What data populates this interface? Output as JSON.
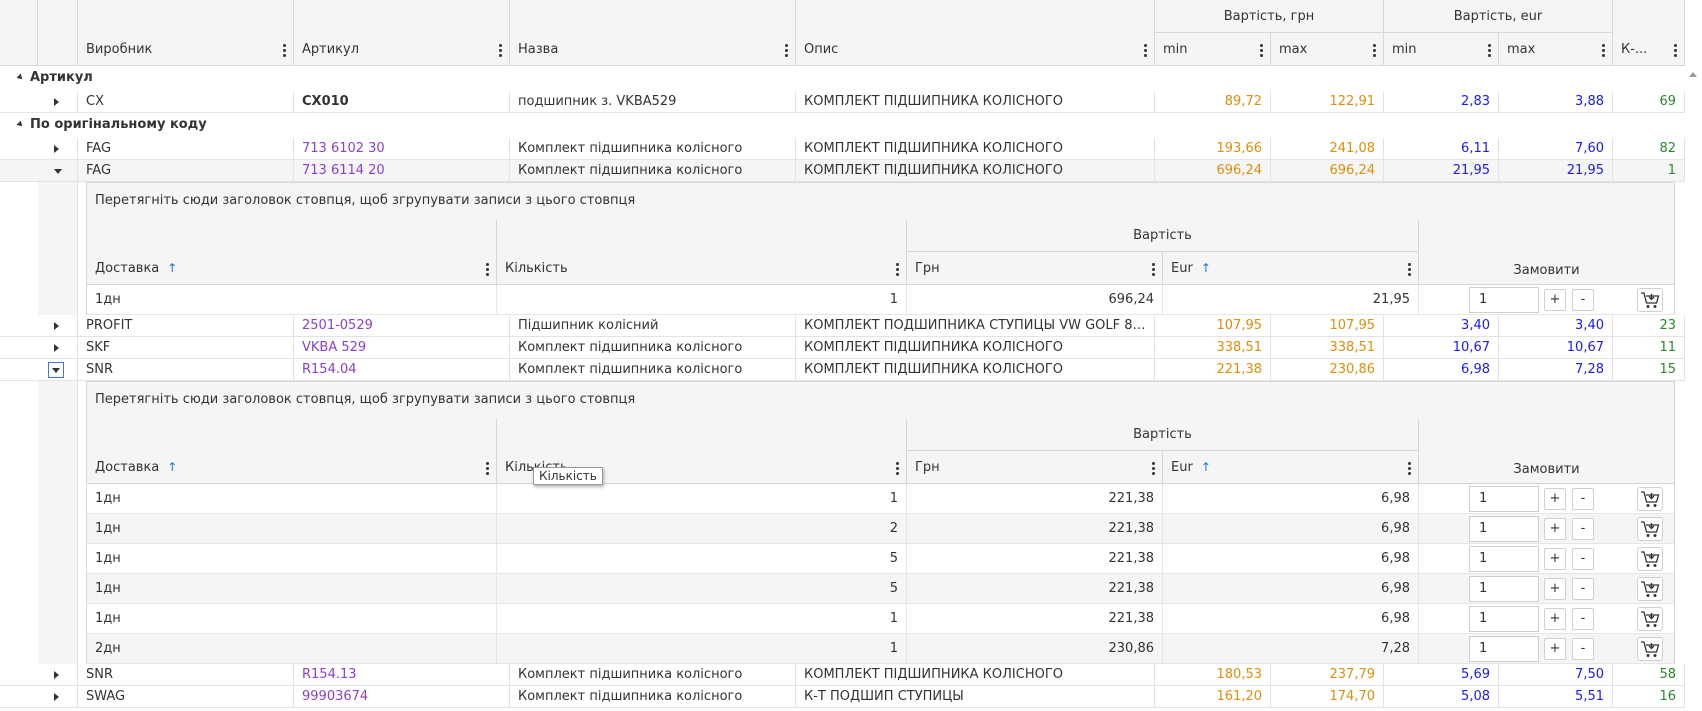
{
  "columns": {
    "manufacturer": "Виробник",
    "article": "Артикул",
    "name": "Назва",
    "description": "Опис",
    "price_uah_group": "Вартість, грн",
    "price_eur_group": "Вартість, eur",
    "min": "min",
    "max": "max",
    "qty_short": "К-..."
  },
  "groups": {
    "article": "Артикул",
    "original": "По оригінальному коду"
  },
  "rows": [
    {
      "manufacturer": "CX",
      "article": "CX010",
      "name": "подшипник з. VKBA529",
      "description": "КОМПЛЕКТ ПІДШИПНИКА КОЛІСНОГО",
      "uah_min": "89,72",
      "uah_max": "122,91",
      "eur_min": "2,83",
      "eur_max": "3,88",
      "count": "69"
    },
    {
      "manufacturer": "FAG",
      "article": "713 6102 30",
      "name": "Комплект підшипника колісного",
      "description": "КОМПЛЕКТ ПІДШИПНИКА КОЛІСНОГО",
      "uah_min": "193,66",
      "uah_max": "241,08",
      "eur_min": "6,11",
      "eur_max": "7,60",
      "count": "82"
    },
    {
      "manufacturer": "FAG",
      "article": "713 6114 20",
      "name": "Комплект підшипника колісного",
      "description": "КОМПЛЕКТ ПІДШИПНИКА КОЛІСНОГО",
      "uah_min": "696,24",
      "uah_max": "696,24",
      "eur_min": "21,95",
      "eur_max": "21,95",
      "count": "1"
    },
    {
      "manufacturer": "PROFIT",
      "article": "2501-0529",
      "name": "Підшипник колісний",
      "description": "КОМПЛЕКТ ПОДШИПНИКА СТУПИЦЫ VW GOLF 85...",
      "uah_min": "107,95",
      "uah_max": "107,95",
      "eur_min": "3,40",
      "eur_max": "3,40",
      "count": "23"
    },
    {
      "manufacturer": "SKF",
      "article": "VKBA 529",
      "name": "Комплект підшипника колісного",
      "description": "КОМПЛЕКТ ПІДШИПНИКА КОЛІСНОГО",
      "uah_min": "338,51",
      "uah_max": "338,51",
      "eur_min": "10,67",
      "eur_max": "10,67",
      "count": "11"
    },
    {
      "manufacturer": "SNR",
      "article": "R154.04",
      "name": "Комплект підшипника колісного",
      "description": "КОМПЛЕКТ ПІДШИПНИКА КОЛІСНОГО",
      "uah_min": "221,38",
      "uah_max": "230,86",
      "eur_min": "6,98",
      "eur_max": "7,28",
      "count": "15"
    },
    {
      "manufacturer": "SNR",
      "article": "R154.13",
      "name": "Комплект підшипника колісного",
      "description": "КОМПЛЕКТ ПІДШИПНИКА КОЛІСНОГО",
      "uah_min": "180,53",
      "uah_max": "237,79",
      "eur_min": "5,69",
      "eur_max": "7,50",
      "count": "58"
    },
    {
      "manufacturer": "SWAG",
      "article": "99903674",
      "name": "Комплект підшипника колісного",
      "description": "К-Т ПОДШИП СТУПИЦЫ",
      "uah_min": "161,20",
      "uah_max": "174,70",
      "eur_min": "5,08",
      "eur_max": "5,51",
      "count": "16"
    }
  ],
  "detail": {
    "group_panel": "Перетягніть сюди заголовок стовпця, щоб згрупувати записи з цього стовпця",
    "delivery": "Доставка",
    "quantity": "Кількість",
    "price_group": "Вартість",
    "uah": "Грн",
    "eur": "Eur",
    "order": "Замовити",
    "plus": "+",
    "minus": "-"
  },
  "detail1_rows": [
    {
      "delivery": "1дн",
      "quantity": "1",
      "uah": "696,24",
      "eur": "21,95",
      "order_qty": "1"
    }
  ],
  "detail2_rows": [
    {
      "delivery": "1дн",
      "quantity": "1",
      "uah": "221,38",
      "eur": "6,98",
      "order_qty": "1"
    },
    {
      "delivery": "1дн",
      "quantity": "2",
      "uah": "221,38",
      "eur": "6,98",
      "order_qty": "1"
    },
    {
      "delivery": "1дн",
      "quantity": "5",
      "uah": "221,38",
      "eur": "6,98",
      "order_qty": "1"
    },
    {
      "delivery": "1дн",
      "quantity": "5",
      "uah": "221,38",
      "eur": "6,98",
      "order_qty": "1"
    },
    {
      "delivery": "1дн",
      "quantity": "1",
      "uah": "221,38",
      "eur": "6,98",
      "order_qty": "1"
    },
    {
      "delivery": "2дн",
      "quantity": "1",
      "uah": "230,86",
      "eur": "7,28",
      "order_qty": "1"
    }
  ],
  "tooltip": "Кількість",
  "colors": {
    "orange": "#e08e0b",
    "blue": "#1a1aff",
    "green": "#2a8a2a",
    "purple": "#8a3fd1",
    "accent": "#1a73e8"
  }
}
